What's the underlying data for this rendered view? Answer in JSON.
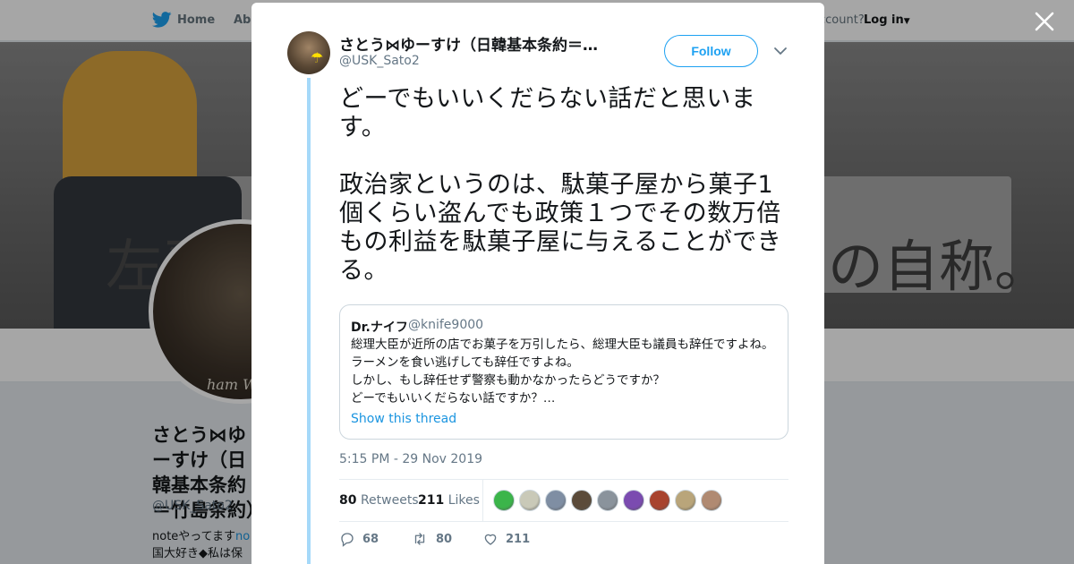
{
  "background": {
    "nav": {
      "home": "Home",
      "about": "Abo",
      "account_prompt": "ccount?",
      "login": "Log in"
    },
    "banner": {
      "left_text": "左翌",
      "right_text": "の自称。"
    },
    "profile": {
      "name": "さとう⋈ゆーすけ（日韓基本条約＝竹島条約）",
      "handle": "@USK_Sato2",
      "bio_line1_prefix": "noteやってます",
      "bio_line1_link": "no",
      "bio_line2": "国大好き◆私は保"
    },
    "signature": "ham Whi"
  },
  "tweet": {
    "author": {
      "name": "さとう⋈ゆーすけ（日韓基本条約＝…",
      "handle": "@USK_Sato2"
    },
    "follow_label": "Follow",
    "text": "どーでもいいくだらない話だと思います。\n\n政治家というのは、駄菓子屋から菓子1個くらい盗んでも政策１つでその数万倍もの利益を駄菓子屋に与えることができる。",
    "quote": {
      "name": "Dr.ナイフ",
      "handle": "@knife9000",
      "text": "総理大臣が近所の店でお菓子を万引したら、総理大臣も議員も辞任ですよね。ラーメンを食い逃げしても辞任ですよね。\nしかし、もし辞任せず警察も動かなかったらどうですか？\nどーでもいいくだらない話ですか？…",
      "thread_label": "Show this thread"
    },
    "timestamp": "5:15 PM - 29 Nov 2019",
    "stats": {
      "retweets_count": "80",
      "retweets_label": "Retweets",
      "likes_count": "211",
      "likes_label": "Likes"
    },
    "liker_colors": [
      "#3bb54a",
      "#c9c9b8",
      "#7f8ea3",
      "#5b4b3a",
      "#8a939c",
      "#7b4bb0",
      "#a8432e",
      "#b9a57a",
      "#b08a72"
    ],
    "actions": {
      "reply_count": "68",
      "retweet_count": "80",
      "like_count": "211"
    }
  },
  "colors": {
    "accent": "#1da1f2",
    "thread_line": "#a5d9f9",
    "link": "#1b95e0"
  }
}
